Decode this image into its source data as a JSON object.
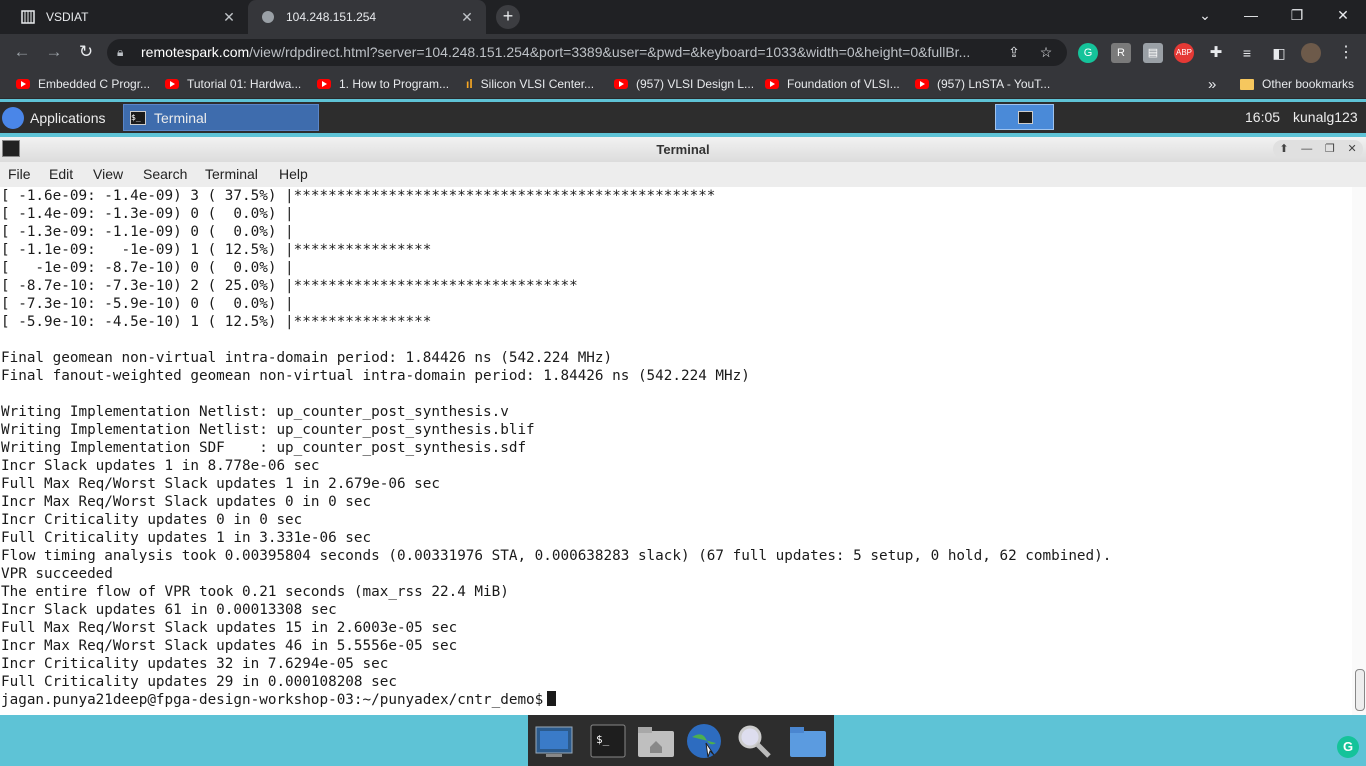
{
  "browser": {
    "tabs": [
      {
        "title": "VSDIAT",
        "close": "✕"
      },
      {
        "title": "104.248.151.254",
        "close": "✕"
      }
    ],
    "new_tab": "+",
    "window_controls": {
      "minimize": "—",
      "maximize": "❐",
      "close": "✕"
    },
    "url_host": "remotespark.com",
    "url_path": "/view/rdpdirect.html?server=104.248.151.254&port=3389&user=&pwd=&keyboard=1033&width=0&height=0&fullBr...",
    "bookmarks": [
      "Embedded C Progr...",
      "Tutorial 01: Hardwa...",
      "1. How to Program...",
      "Silicon VLSI Center...",
      "(957) VLSI Design L...",
      "Foundation of VLSI...",
      "(957) LnSTA - YouT..."
    ],
    "bookmarks_overflow": "»",
    "other_bookmarks": "Other bookmarks"
  },
  "desktop_panel": {
    "applications": "Applications",
    "task_title": "Terminal",
    "clock": "16:05",
    "user": "kunalg123"
  },
  "terminal": {
    "window_title": "Terminal",
    "menu": [
      "File",
      "Edit",
      "View",
      "Search",
      "Terminal",
      "Help"
    ],
    "lines": [
      "[ -1.6e-09: -1.4e-09) 3 ( 37.5%) |*************************************************",
      "[ -1.4e-09: -1.3e-09) 0 (  0.0%) |",
      "[ -1.3e-09: -1.1e-09) 0 (  0.0%) |",
      "[ -1.1e-09:   -1e-09) 1 ( 12.5%) |****************",
      "[   -1e-09: -8.7e-10) 0 (  0.0%) |",
      "[ -8.7e-10: -7.3e-10) 2 ( 25.0%) |*********************************",
      "[ -7.3e-10: -5.9e-10) 0 (  0.0%) |",
      "[ -5.9e-10: -4.5e-10) 1 ( 12.5%) |****************",
      "",
      "Final geomean non-virtual intra-domain period: 1.84426 ns (542.224 MHz)",
      "Final fanout-weighted geomean non-virtual intra-domain period: 1.84426 ns (542.224 MHz)",
      "",
      "Writing Implementation Netlist: up_counter_post_synthesis.v",
      "Writing Implementation Netlist: up_counter_post_synthesis.blif",
      "Writing Implementation SDF    : up_counter_post_synthesis.sdf",
      "Incr Slack updates 1 in 8.778e-06 sec",
      "Full Max Req/Worst Slack updates 1 in 2.679e-06 sec",
      "Incr Max Req/Worst Slack updates 0 in 0 sec",
      "Incr Criticality updates 0 in 0 sec",
      "Full Criticality updates 1 in 3.331e-06 sec",
      "Flow timing analysis took 0.00395804 seconds (0.00331976 STA, 0.000638283 slack) (67 full updates: 5 setup, 0 hold, 62 combined).",
      "VPR succeeded",
      "The entire flow of VPR took 0.21 seconds (max_rss 22.4 MiB)",
      "Incr Slack updates 61 in 0.00013308 sec",
      "Full Max Req/Worst Slack updates 15 in 2.6003e-05 sec",
      "Incr Max Req/Worst Slack updates 46 in 5.5556e-05 sec",
      "Incr Criticality updates 32 in 7.6294e-05 sec",
      "Full Criticality updates 29 in 0.000108208 sec"
    ],
    "prompt": "jagan.punya21deep@fpga-design-workshop-03:~/punyadex/cntr_demo$"
  },
  "colors": {
    "chrome_dark": "#202124",
    "toolbar": "#35363a",
    "panel": "#2d2d2d",
    "desktop": "#5ec3d6",
    "task_active": "#3e6cad"
  }
}
